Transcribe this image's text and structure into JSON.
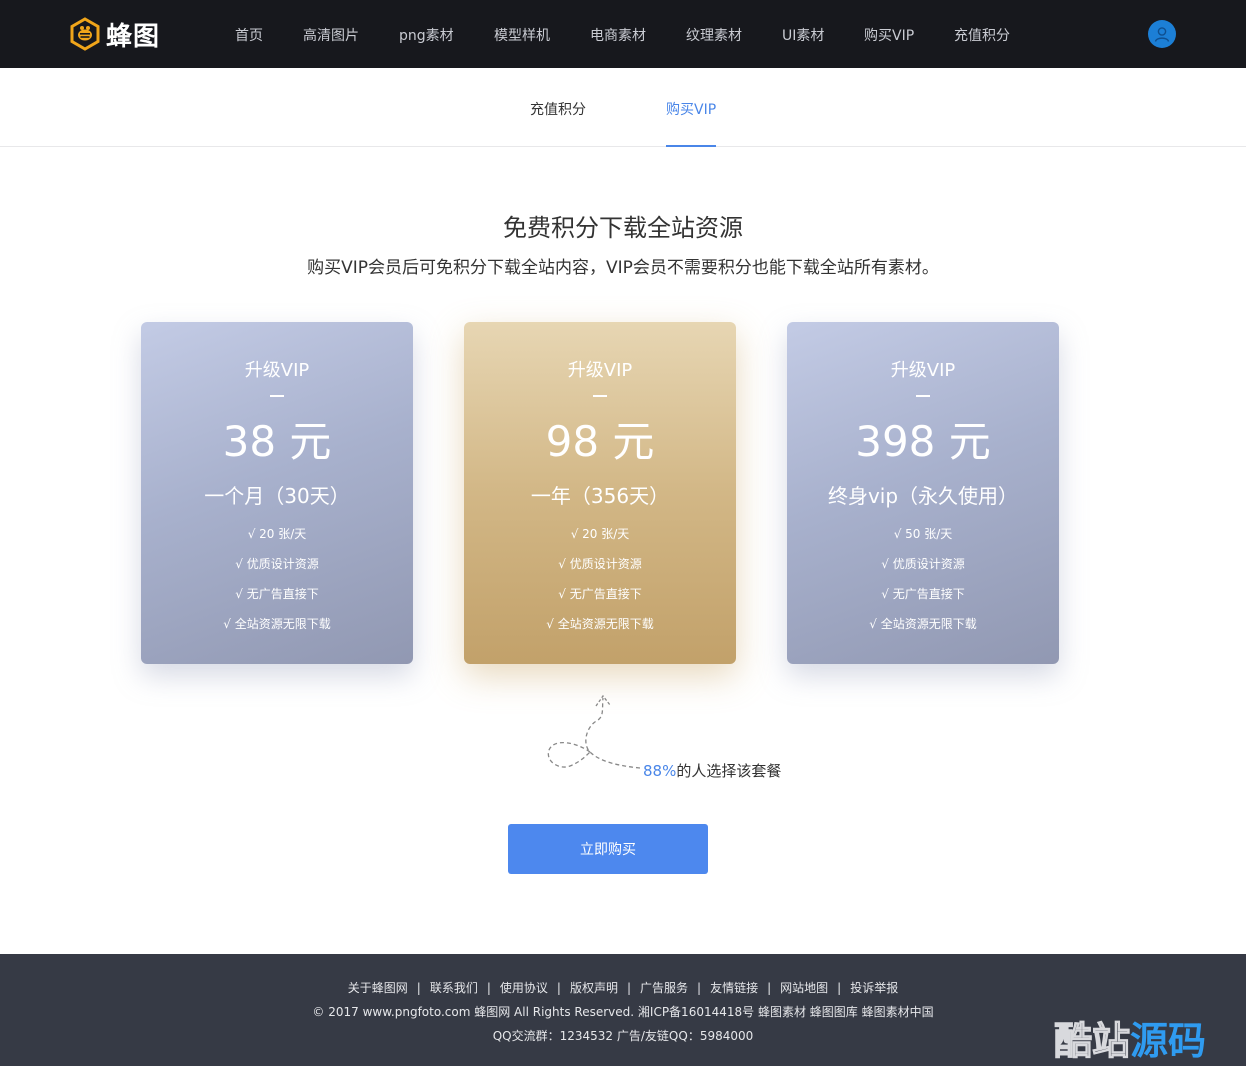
{
  "brand": {
    "name": "蜂图",
    "accent": "#4a86e8",
    "logo_color": "#f0a51a"
  },
  "nav": {
    "items": [
      {
        "label": "首页"
      },
      {
        "label": "高清图片"
      },
      {
        "label": "png素材"
      },
      {
        "label": "模型样机"
      },
      {
        "label": "电商素材"
      },
      {
        "label": "纹理素材"
      },
      {
        "label": "UI素材"
      },
      {
        "label": "购买VIP"
      },
      {
        "label": "充值积分"
      }
    ],
    "user_icon": "user-icon"
  },
  "subtabs": {
    "items": [
      {
        "label": "充值积分",
        "active": false
      },
      {
        "label": "购买VIP",
        "active": true
      }
    ]
  },
  "hero": {
    "title": "免费积分下载全站资源",
    "subtitle": "购买VIP会员后可免积分下载全站内容，VIP会员不需要积分也能下载全站所有素材。"
  },
  "plans": [
    {
      "title": "升级VIP",
      "price": "38 元",
      "period": "一个月（30天）",
      "features": [
        "√ 20 张/天",
        "√ 优质设计资源",
        "√ 无广告直接下",
        "√ 全站资源无限下载"
      ],
      "style": "blue"
    },
    {
      "title": "升级VIP",
      "price": "98 元",
      "period": "一年（356天）",
      "features": [
        "√ 20 张/天",
        "√ 优质设计资源",
        "√ 无广告直接下",
        "√ 全站资源无限下载"
      ],
      "style": "gold"
    },
    {
      "title": "升级VIP",
      "price": "398 元",
      "period": "终身vip（永久使用）",
      "features": [
        "√ 50 张/天",
        "√ 优质设计资源",
        "√ 无广告直接下",
        "√ 全站资源无限下载"
      ],
      "style": "blue"
    }
  ],
  "choose_note": {
    "percent": "88%",
    "text": "的人选择该套餐"
  },
  "buy_button": "立即购买",
  "footer": {
    "links": [
      "关于蜂图网",
      "联系我们",
      "使用协议",
      "版权声明",
      "广告服务",
      "友情链接",
      "网站地图",
      "投诉举报"
    ],
    "separator": "|",
    "copyright": "© 2017 www.pngfoto.com 蜂图网 All Rights Reserved. 湘ICP备16014418号 蜂图素材 蜂图图库 蜂图素材中国",
    "qq": "QQ交流群：1234532 广告/友链QQ：5984000"
  },
  "watermark": {
    "part1": "酷站",
    "part2": "源码"
  }
}
